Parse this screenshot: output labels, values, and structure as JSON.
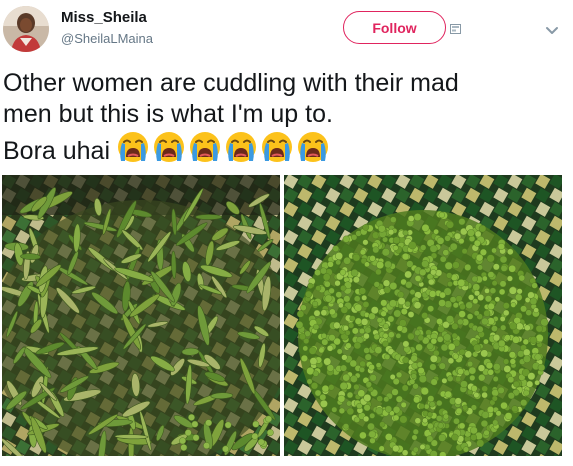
{
  "tweet": {
    "author": {
      "display_name": "Miss_Sheila",
      "handle": "@SheilaLMaina"
    },
    "follow_label": "Follow",
    "text": "Other women are cuddling with their mad\nmen but this is what I'm up to.\nBora uhai",
    "emoji": [
      "loudly-crying-face",
      "loudly-crying-face",
      "loudly-crying-face",
      "loudly-crying-face",
      "loudly-crying-face",
      "loudly-crying-face"
    ],
    "media": [
      {
        "name": "green-pea-pods-in-basket-photo"
      },
      {
        "name": "shelled-green-peas-in-basket-photo"
      }
    ]
  },
  "colors": {
    "follow_accent": "#e0245e",
    "text": "#14171a",
    "secondary_text": "#657786",
    "emoji_face": "#fcc21b",
    "emoji_tears": "#3b9ae1"
  },
  "icons": [
    "avatar",
    "direct-message-icon",
    "chevron-down-icon",
    "loudly-crying-face-emoji"
  ]
}
